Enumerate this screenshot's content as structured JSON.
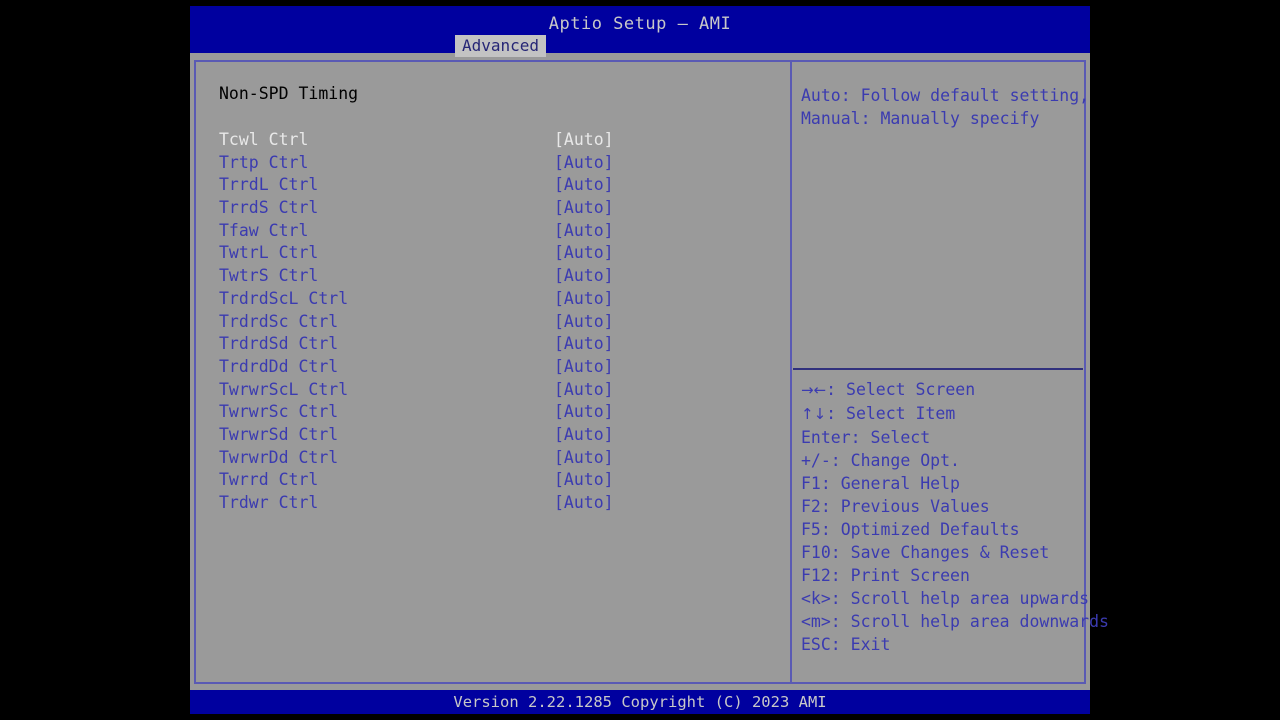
{
  "window": {
    "title": "Aptio Setup – AMI",
    "tabs": [
      {
        "label": "Advanced",
        "active": true
      }
    ]
  },
  "settings_panel": {
    "section_heading": "Non-SPD Timing",
    "rows": [
      {
        "label": "Tcwl Ctrl",
        "value": "[Auto]",
        "selected": true
      },
      {
        "label": "Trtp Ctrl",
        "value": "[Auto]",
        "selected": false
      },
      {
        "label": "TrrdL Ctrl",
        "value": "[Auto]",
        "selected": false
      },
      {
        "label": "TrrdS Ctrl",
        "value": "[Auto]",
        "selected": false
      },
      {
        "label": "Tfaw Ctrl",
        "value": "[Auto]",
        "selected": false
      },
      {
        "label": "TwtrL Ctrl",
        "value": "[Auto]",
        "selected": false
      },
      {
        "label": "TwtrS Ctrl",
        "value": "[Auto]",
        "selected": false
      },
      {
        "label": "TrdrdScL Ctrl",
        "value": "[Auto]",
        "selected": false
      },
      {
        "label": "TrdrdSc Ctrl",
        "value": "[Auto]",
        "selected": false
      },
      {
        "label": "TrdrdSd Ctrl",
        "value": "[Auto]",
        "selected": false
      },
      {
        "label": "TrdrdDd Ctrl",
        "value": "[Auto]",
        "selected": false
      },
      {
        "label": "TwrwrScL Ctrl",
        "value": "[Auto]",
        "selected": false
      },
      {
        "label": "TwrwrSc Ctrl",
        "value": "[Auto]",
        "selected": false
      },
      {
        "label": "TwrwrSd Ctrl",
        "value": "[Auto]",
        "selected": false
      },
      {
        "label": "TwrwrDd Ctrl",
        "value": "[Auto]",
        "selected": false
      },
      {
        "label": "Twrrd Ctrl",
        "value": "[Auto]",
        "selected": false
      },
      {
        "label": "Trdwr Ctrl",
        "value": "[Auto]",
        "selected": false
      }
    ]
  },
  "help_panel": {
    "description_lines": [
      "Auto: Follow default setting,",
      "Manual: Manually specify"
    ],
    "key_legend": [
      {
        "glyph": "→←",
        "text": ": Select Screen"
      },
      {
        "glyph": "↑↓",
        "text": ": Select Item"
      },
      {
        "glyph": "",
        "text": "Enter: Select"
      },
      {
        "glyph": "",
        "text": "+/-: Change Opt."
      },
      {
        "glyph": "",
        "text": "F1: General Help"
      },
      {
        "glyph": "",
        "text": "F2: Previous Values"
      },
      {
        "glyph": "",
        "text": "F5: Optimized Defaults"
      },
      {
        "glyph": "",
        "text": "F10: Save Changes & Reset"
      },
      {
        "glyph": "",
        "text": "F12: Print Screen"
      },
      {
        "glyph": "",
        "text": "<k>: Scroll help area upwards"
      },
      {
        "glyph": "",
        "text": "<m>: Scroll help area downwards"
      },
      {
        "glyph": "",
        "text": "ESC: Exit"
      }
    ]
  },
  "footer": {
    "version_text": "Version 2.22.1285 Copyright (C) 2023 AMI"
  },
  "colors": {
    "header_blue": "#00009f",
    "body_gray": "#9a9a9a",
    "text_blue": "#3b3bb0",
    "selected_text": "#e8e8e8",
    "border_violet": "#5a5ab4",
    "tab_bg": "#c3c3c3",
    "tab_text": "#262676",
    "title_text": "#c8c8c8"
  }
}
